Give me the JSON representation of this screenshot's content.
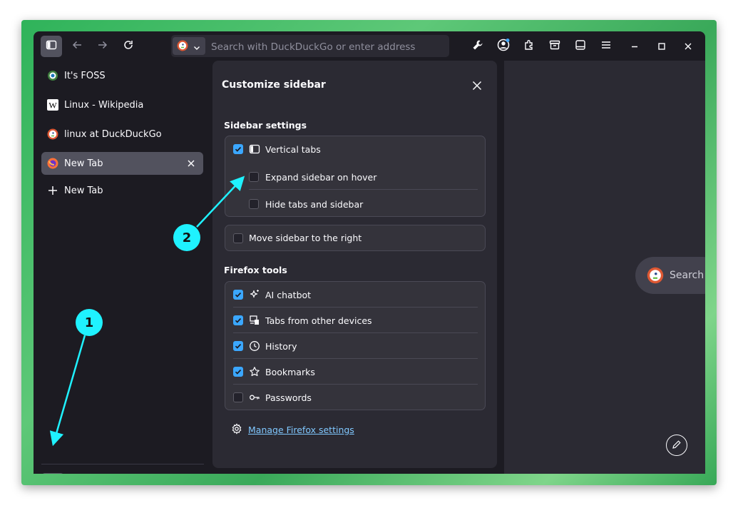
{
  "toolbar": {
    "url_placeholder": "Search with DuckDuckGo or enter address",
    "icons": [
      "sidebar-toggle-icon",
      "back-arrow-icon",
      "forward-arrow-icon",
      "reload-icon",
      "duckduckgo-icon",
      "wrench-icon",
      "account-icon",
      "extensions-icon",
      "downloads-icon",
      "sidebar-layout-icon",
      "menu-icon",
      "minimize-icon",
      "maximize-icon",
      "close-icon"
    ]
  },
  "tabs": [
    {
      "title": "It's FOSS",
      "icon": "itsfoss-favicon"
    },
    {
      "title": "Linux - Wikipedia",
      "icon": "wikipedia-favicon"
    },
    {
      "title": "linux at DuckDuckGo",
      "icon": "duckduckgo-favicon"
    },
    {
      "title": "New Tab",
      "icon": "firefox-favicon",
      "selected": true
    }
  ],
  "new_tab_label": "New Tab",
  "panel": {
    "title": "Customize sidebar",
    "sidebar_settings": {
      "heading": "Sidebar settings",
      "vertical_tabs": {
        "label": "Vertical tabs",
        "checked": true
      },
      "expand_on_hover": {
        "label": "Expand sidebar on hover",
        "checked": false
      },
      "hide_tabs": {
        "label": "Hide tabs and sidebar",
        "checked": false
      },
      "move_right": {
        "label": "Move sidebar to the right",
        "checked": false
      }
    },
    "firefox_tools": {
      "heading": "Firefox tools",
      "items": [
        {
          "label": "AI chatbot",
          "checked": true,
          "icon": "sparkle-icon"
        },
        {
          "label": "Tabs from other devices",
          "checked": true,
          "icon": "synced-tabs-icon"
        },
        {
          "label": "History",
          "checked": true,
          "icon": "history-icon"
        },
        {
          "label": "Bookmarks",
          "checked": true,
          "icon": "bookmark-star-icon"
        },
        {
          "label": "Passwords",
          "checked": false,
          "icon": "key-icon"
        }
      ]
    },
    "manage_link": "Manage Firefox settings"
  },
  "content": {
    "search_label": "Search"
  },
  "annotations": {
    "badge_1": "1",
    "badge_2": "2",
    "color": "#1ff2ff"
  },
  "colors": {
    "accent_checkbox": "#3ba7ff",
    "window_bg": "#1c1b22",
    "panel_bg": "#2b2a33",
    "link": "#80c8ff"
  }
}
